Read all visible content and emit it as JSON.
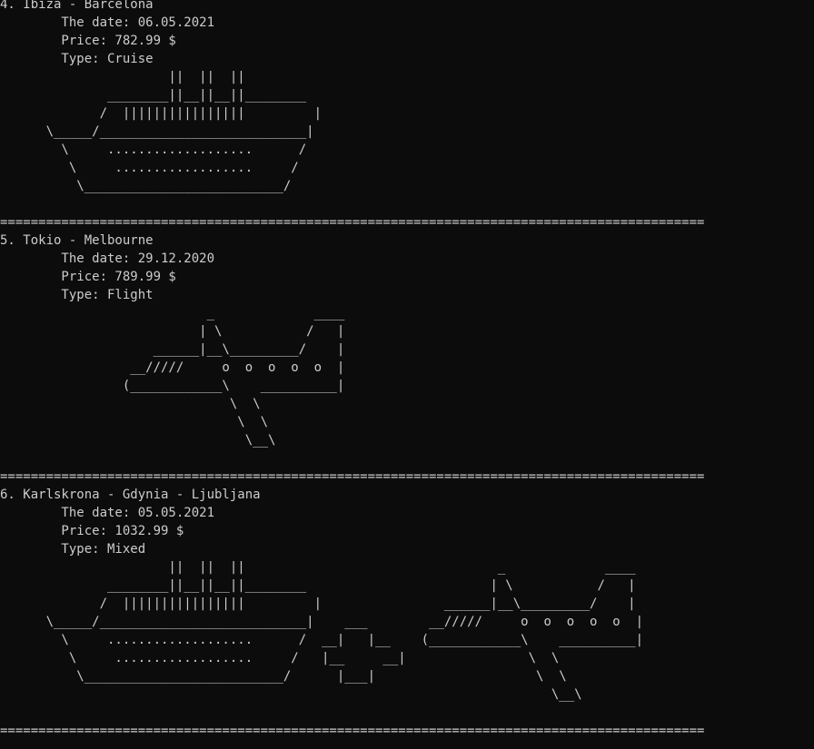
{
  "console": {
    "lines": [
      "4. Ibiza - Barcelona",
      "        The date: 06.05.2021",
      "        Price: 782.99 $",
      "        Type: Cruise",
      "                      ||  ||  ||",
      "              ________||__||__||________",
      "             /  ||||||||||||||||         |",
      "      \\_____/___________________________|",
      "        \\     ...................      /",
      "         \\     ..................     /",
      "          \\__________________________/",
      "",
      "============================================================================================",
      "5. Tokio - Melbourne",
      "        The date: 29.12.2020",
      "        Price: 789.99 $",
      "        Type: Flight",
      "                           _             ____",
      "                          | \\           /   |",
      "                    ______|__\\_________/    |",
      "                 __/////     o  o  o  o  o  |",
      "                (____________\\    __________|",
      "                              \\  \\",
      "                               \\  \\",
      "                                \\__\\",
      "",
      "============================================================================================",
      "6. Karlskrona - Gdynia - Ljubljana",
      "        The date: 05.05.2021",
      "        Price: 1032.99 $",
      "        Type: Mixed",
      "                      ||  ||  ||                                 _             ____",
      "              ________||__||__||________                        | \\           /   |",
      "             /  ||||||||||||||||         |                ______|__\\_________/    |",
      "      \\_____/___________________________|    ___        __/////     o  o  o  o  o  |",
      "        \\     ...................      /  __|   |__    (____________\\    __________|",
      "         \\     ..................     /   |__     __|                \\  \\",
      "          \\__________________________/      |___|                     \\  \\",
      "                                                                        \\__\\",
      "",
      "============================================================================================",
      "",
      ""
    ]
  }
}
